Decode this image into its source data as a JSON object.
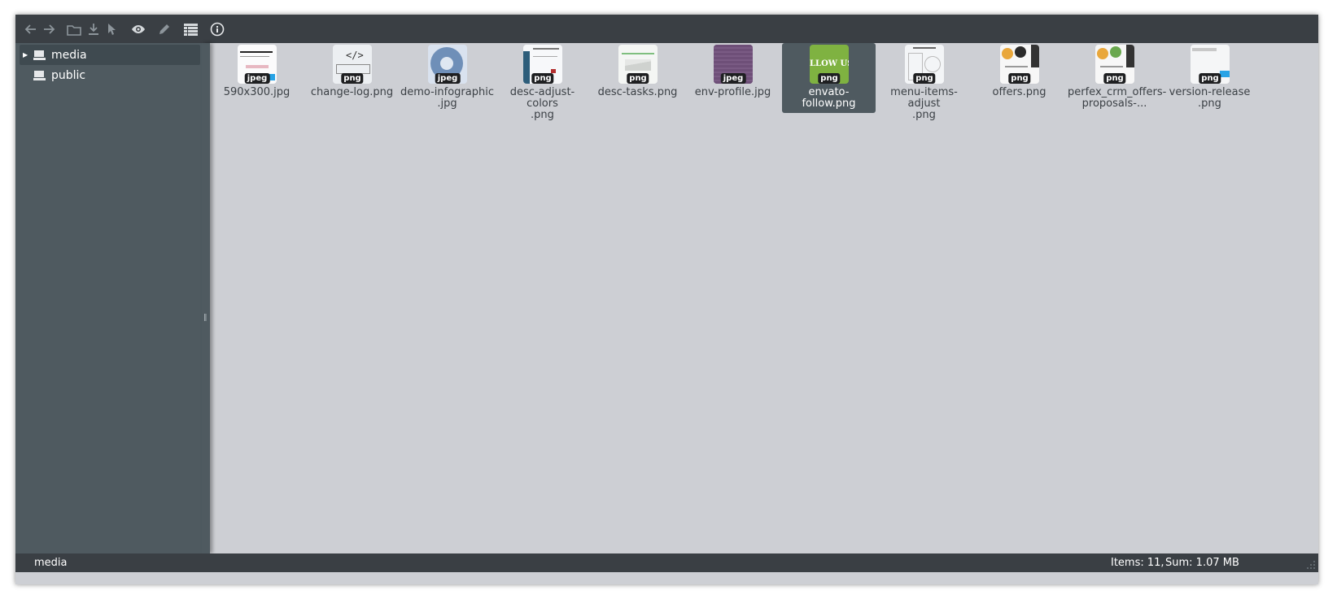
{
  "toolbar": {
    "buttons": [
      {
        "name": "back-icon"
      },
      {
        "name": "forward-icon"
      },
      {
        "name": "folder-icon"
      },
      {
        "name": "download-icon"
      },
      {
        "name": "select-pointer-icon"
      },
      {
        "name": "eye-icon"
      },
      {
        "name": "pencil-icon"
      },
      {
        "name": "list-view-icon"
      },
      {
        "name": "info-icon"
      }
    ]
  },
  "sidebar": {
    "items": [
      {
        "label": "media",
        "icon": "drive-icon",
        "expanded": false,
        "active": true
      },
      {
        "label": "public",
        "icon": "drive-icon",
        "active": false
      }
    ]
  },
  "files": [
    {
      "name": "590x300.jpg",
      "line1": "590x300.jpg",
      "line2": "",
      "badge": "jpeg",
      "thumb": "white-doc"
    },
    {
      "name": "change-log.png",
      "line1": "change-log.png",
      "line2": "",
      "badge": "png",
      "thumb": "changelog"
    },
    {
      "name": "demo-infographic.jpg",
      "line1": "demo-infographic",
      "line2": ".jpg",
      "badge": "jpeg",
      "thumb": "blue-circle"
    },
    {
      "name": "desc-adjust-colors.png",
      "line1": "desc-adjust-colors",
      "line2": ".png",
      "badge": "png",
      "thumb": "white-doc"
    },
    {
      "name": "desc-tasks.png",
      "line1": "desc-tasks.png",
      "line2": "",
      "badge": "png",
      "thumb": "white-doc"
    },
    {
      "name": "env-profile.jpg",
      "line1": "env-profile.jpg",
      "line2": "",
      "badge": "jpeg",
      "thumb": "purple"
    },
    {
      "name": "envato-follow.png",
      "line1": "envato-follow.png",
      "line2": "",
      "badge": "png",
      "thumb": "green",
      "thumb_text": "LLOW US",
      "selected": true
    },
    {
      "name": "menu-items-adjust.png",
      "line1": "menu-items-adjust",
      "line2": ".png",
      "badge": "png",
      "thumb": "white-doc"
    },
    {
      "name": "offers.png",
      "line1": "offers.png",
      "line2": "",
      "badge": "png",
      "thumb": "white-doc"
    },
    {
      "name": "perfex_crm_offers-proposals-...",
      "line1": "perfex_crm_offers-",
      "line2": "proposals-...",
      "badge": "png",
      "thumb": "white-doc"
    },
    {
      "name": "version-release.png",
      "line1": "version-release",
      "line2": ".png",
      "badge": "png",
      "thumb": "white-doc"
    }
  ],
  "statusbar": {
    "path": "media",
    "items": "Items: 11,",
    "sum": "Sum: 1.07 MB"
  },
  "colors": {
    "toolbar_bg": "#3a3f44",
    "sidebar_bg": "#4f5a60",
    "content_bg": "#cdcfd4",
    "selected_bg": "#4f5a60",
    "badge_bg": "#1e1f21"
  }
}
